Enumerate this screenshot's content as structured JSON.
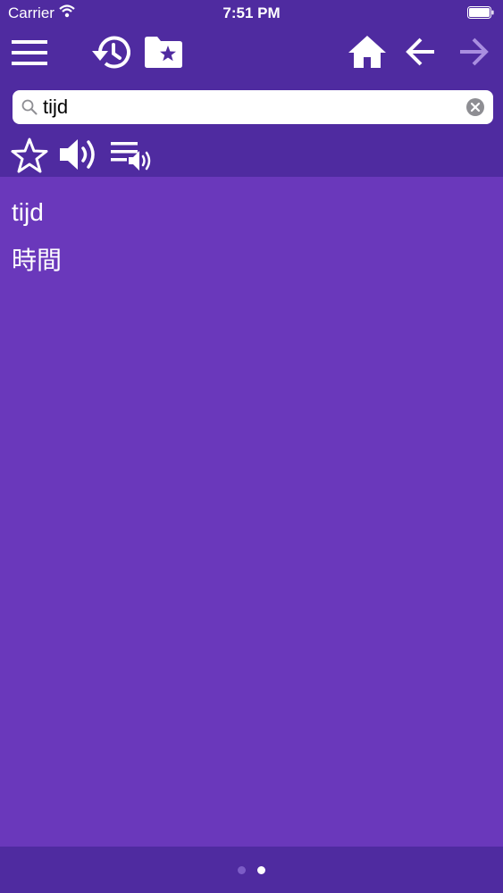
{
  "status_bar": {
    "carrier": "Carrier",
    "time": "7:51 PM"
  },
  "toolbar": {
    "icons": [
      "menu-icon",
      "history-icon",
      "favorites-folder-icon",
      "home-icon",
      "back-arrow-icon",
      "forward-arrow-icon"
    ]
  },
  "search": {
    "value": "tijd"
  },
  "actions": {
    "icons": [
      "star-icon",
      "speaker-icon",
      "playlist-audio-icon"
    ]
  },
  "entry": {
    "word": "tijd",
    "translation": "時間"
  },
  "pager": {
    "pages": 2,
    "current": 2
  },
  "colors": {
    "bar": "#4f2ba0",
    "content": "#6a38bb",
    "forward_disabled": "#a98ee0"
  }
}
